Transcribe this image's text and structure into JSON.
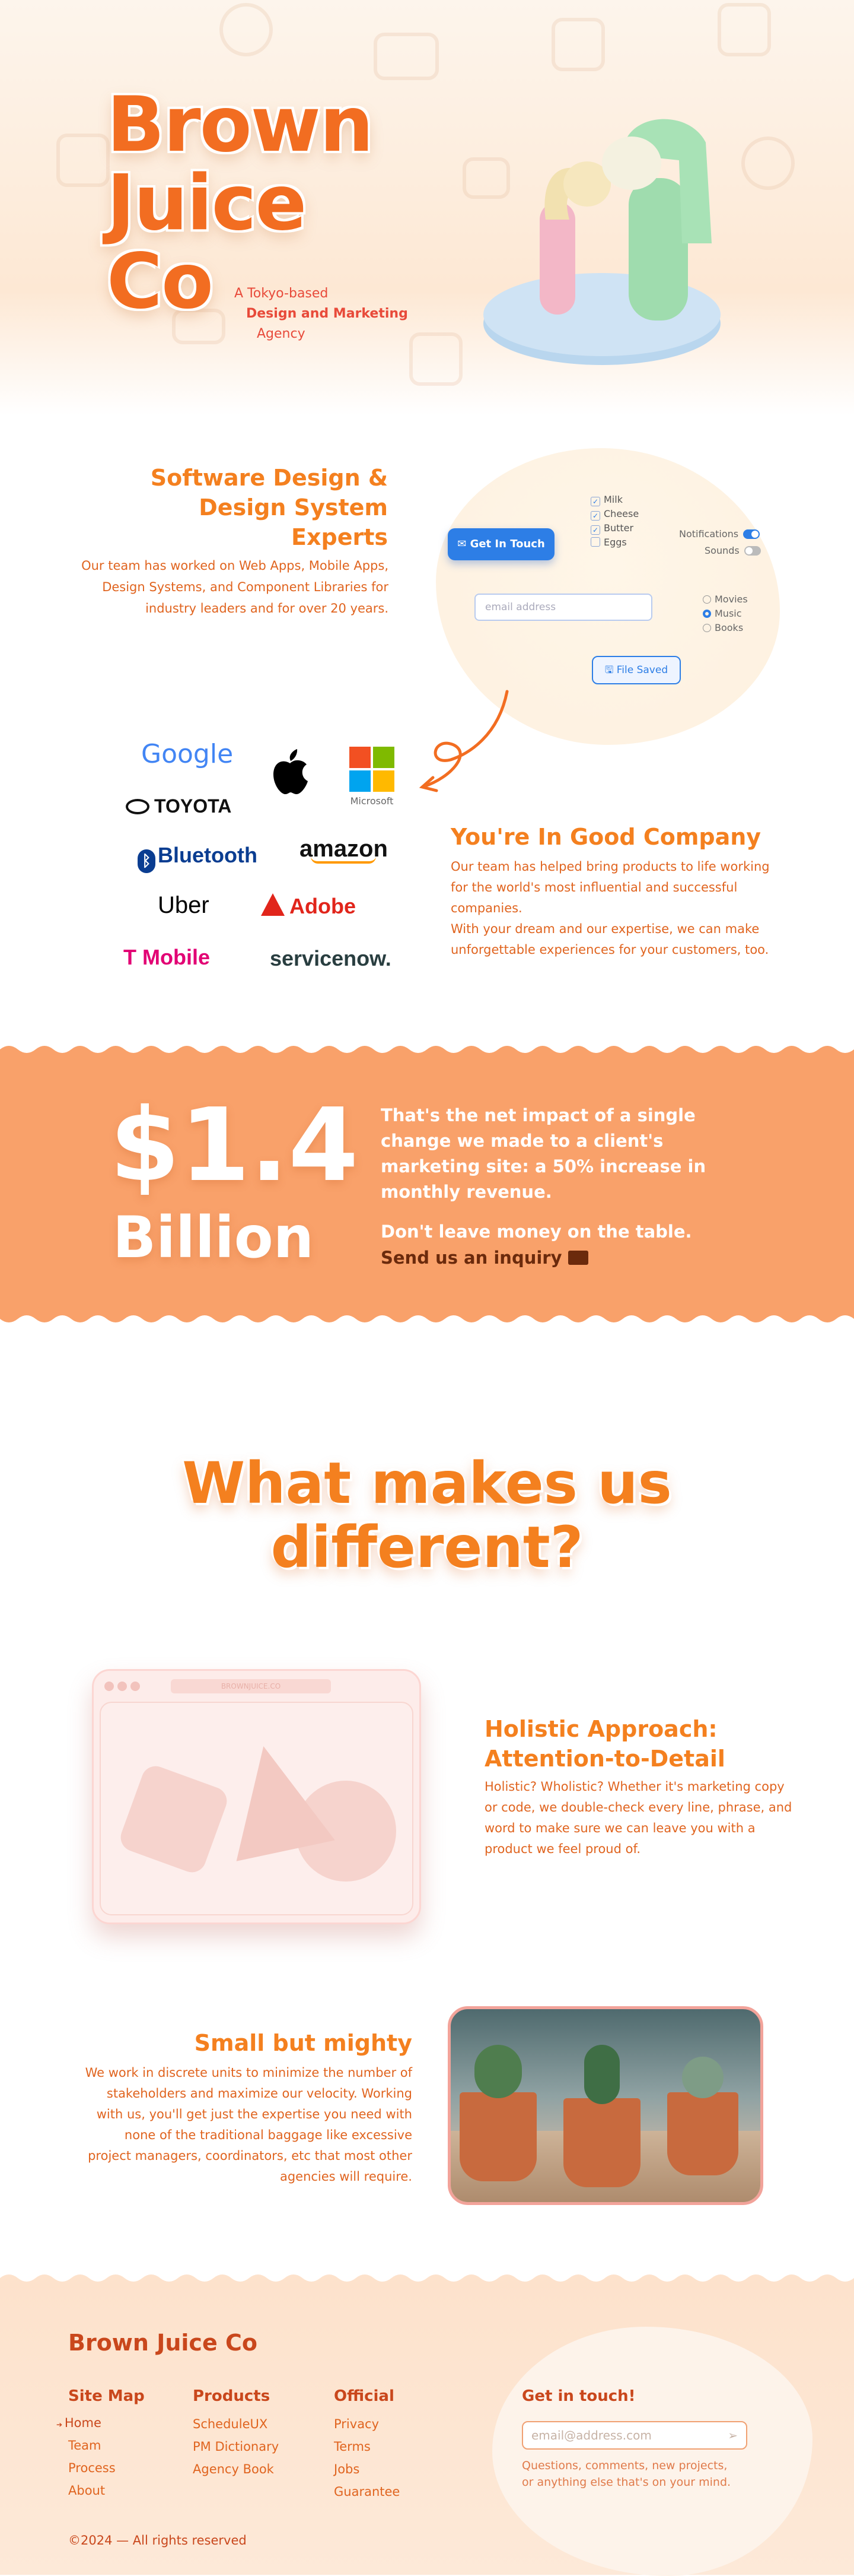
{
  "hero": {
    "title_lines": [
      "Brown",
      "Juice",
      "Co"
    ],
    "tagline": [
      "A Tokyo-based",
      "Design and Marketing",
      "Agency"
    ]
  },
  "software": {
    "title_lines": [
      "Software Design &",
      "Design System",
      "Experts"
    ],
    "body": "Our team has worked on Web Apps, Mobile Apps, Design Systems, and Component Libraries for industry leaders and for over 20 years.",
    "mock": {
      "get_in_touch": "Get In Touch",
      "checkboxes": [
        "Milk",
        "Cheese",
        "Butter",
        "Eggs"
      ],
      "toggles": [
        "Notifications",
        "Sounds"
      ],
      "email_placeholder": "email address",
      "radios": [
        "Movies",
        "Music",
        "Books"
      ],
      "file_saved": "File Saved"
    }
  },
  "logos": {
    "google": "Google",
    "toyota": "TOYOTA",
    "microsoft": "Microsoft",
    "bluetooth": "Bluetooth",
    "amazon": "amazon",
    "uber": "Uber",
    "adobe": "Adobe",
    "tmobile": "T Mobile",
    "servicenow": "servicenow."
  },
  "company": {
    "title": "You're In Good Company",
    "body1": "Our team has helped bring products to life working for the world's most influential and successful companies.",
    "body2": "With your dream and our expertise, we can make unforgettable experiences for your customers, too."
  },
  "billion": {
    "number": "$1.4",
    "word": "Billion",
    "text": "That's the net impact of a single change we made to a client's marketing site: a 50% increase in monthly revenue.",
    "cta_line": "Don't leave money on the table.",
    "cta_link": "Send us an inquiry"
  },
  "different": {
    "title_lines": [
      "What makes us",
      "different?"
    ],
    "window_title": "BROWNJUICE.CO",
    "holistic_title_lines": [
      "Holistic Approach:",
      "Attention-to-Detail"
    ],
    "holistic_body": "Holistic? Wholistic? Whether it's marketing copy or code, we double-check every line, phrase, and word to make sure we can leave you with a product we feel proud of.",
    "small_title": "Small but mighty",
    "small_body": "We work in discrete units to minimize the number of stakeholders and maximize our velocity. Working with us, you'll get just the expertise you need with none of the traditional baggage like excessive project managers, coordinators, etc that most other agencies will require."
  },
  "footer": {
    "brand": "Brown Juice Co",
    "sitemap": {
      "heading": "Site Map",
      "links": [
        "Home",
        "Team",
        "Process",
        "About"
      ]
    },
    "products": {
      "heading": "Products",
      "links": [
        "ScheduleUX",
        "PM Dictionary",
        "Agency Book"
      ]
    },
    "official": {
      "heading": "Official",
      "links": [
        "Privacy",
        "Terms",
        "Jobs",
        "Guarantee"
      ]
    },
    "contact": {
      "heading": "Get in touch!",
      "placeholder": "email@address.com",
      "note_lines": [
        "Questions, comments, new projects,",
        "or anything else that's on your mind."
      ]
    },
    "copyright": "©2024 — All rights reserved"
  },
  "colors": {
    "accent": "#f26d21",
    "band": "#f9a16a",
    "footer": "#fde2cc"
  }
}
